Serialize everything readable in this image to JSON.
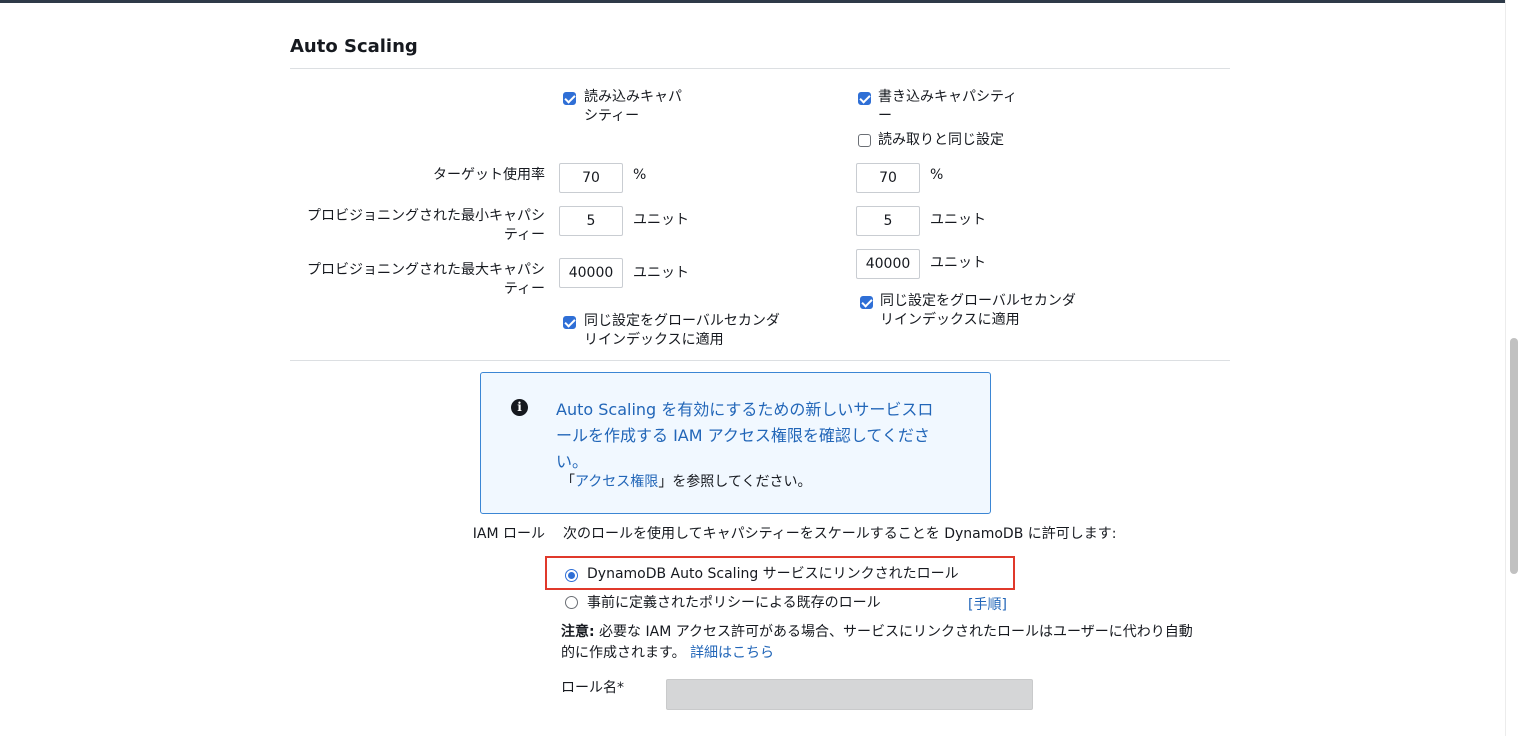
{
  "section": {
    "title": "Auto Scaling"
  },
  "read": {
    "capacity_label_line1": "読み込みキャパ",
    "capacity_label_line2": "シティー",
    "target_value": "70",
    "min_value": "5",
    "max_value": "40000",
    "apply_gsi_line1": "同じ設定をグローバルセカンダ",
    "apply_gsi_line2": "リインデックスに適用"
  },
  "write": {
    "capacity_label_line1": "書き込みキャパシティ",
    "capacity_label_line2": "ー",
    "same_as_read": "読み取りと同じ設定",
    "target_value": "70",
    "min_value": "5",
    "max_value": "40000",
    "apply_gsi_line1": "同じ設定をグローバルセカンダ",
    "apply_gsi_line2": "リインデックスに適用"
  },
  "labels": {
    "target_utilization": "ターゲット使用率",
    "min_capacity_line1": "プロビジョニングされた最小キャパシ",
    "min_capacity_line2": "ティー",
    "max_capacity_line1": "プロビジョニングされた最大キャパシ",
    "max_capacity_line2": "ティー",
    "percent": "%",
    "unit": "ユニット"
  },
  "info": {
    "message_line1": "Auto Scaling を有効にするための新しいサービスロ",
    "message_line2": "ールを作成する IAM アクセス権限を確認してくださ",
    "message_line3": "い。",
    "ref_prefix": "「",
    "ref_link": "アクセス権限",
    "ref_suffix": "」を参照してください。"
  },
  "iam": {
    "label": "IAM ロール",
    "description": "次のロールを使用してキャパシティーをスケールすることを DynamoDB に許可します:",
    "option_linked": "DynamoDB Auto Scaling サービスにリンクされたロール",
    "option_existing": "事前に定義されたポリシーによる既存のロール",
    "steps_link": "[手順]",
    "note_bold": "注意:",
    "note_text_line1": " 必要な IAM アクセス許可がある場合、サービスにリンクされたロールはユーザーに代わり自動",
    "note_text_line2": "的に作成されます。",
    "details_link": "詳細はこちら",
    "role_name_label": "ロール名*",
    "role_name_value": ""
  }
}
